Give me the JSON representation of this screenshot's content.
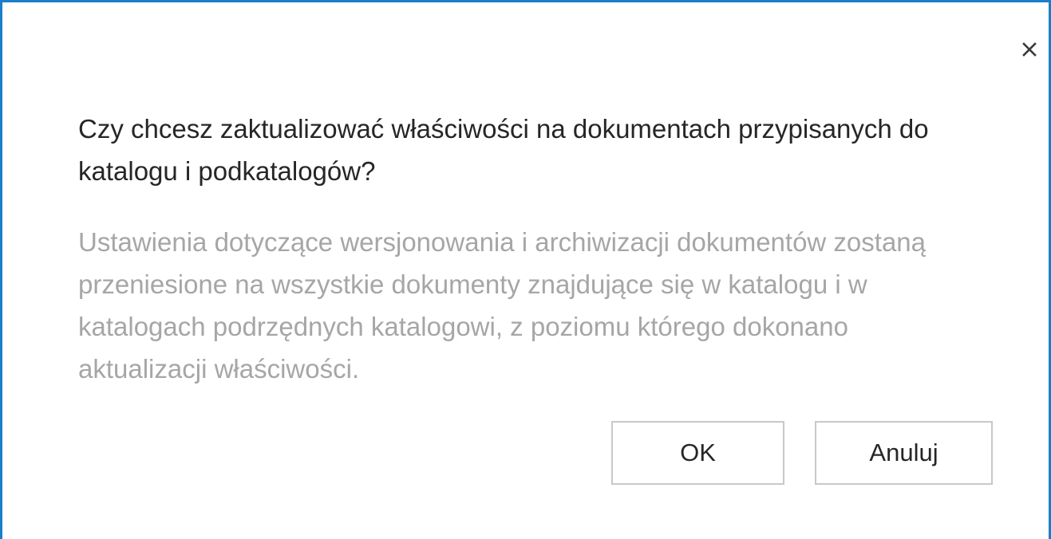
{
  "dialog": {
    "title": "Czy chcesz zaktualizować właściwości na dokumentach przypisanych do katalogu i podkatalogów?",
    "message": "Ustawienia dotyczące wersjonowania i archiwizacji dokumentów zostaną przeniesione na wszystkie dokumenty znajdujące się w katalogu i w katalogach podrzędnych katalogowi, z poziomu którego dokonano aktualizacji właściwości.",
    "ok_label": "OK",
    "cancel_label": "Anuluj",
    "close_icon": "close-icon"
  },
  "colors": {
    "accent_border": "#1a7fc9",
    "title_text": "#262626",
    "message_text": "#a6a6a6",
    "button_border": "#c8c8c8"
  }
}
